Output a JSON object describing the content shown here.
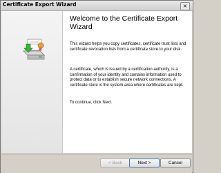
{
  "window": {
    "title": "Certificate Export Wizard",
    "close_glyph": "×"
  },
  "left_panel": {
    "icon": "certificate-export-icon"
  },
  "content": {
    "heading": "Welcome to the Certificate Export Wizard",
    "paragraph1": "This wizard helps you copy certificates, certificate trust lists and certificate revocation lists from a certificate store to your disk.",
    "paragraph2": "A certificate, which is issued by a certification authority, is a confirmation of your identity and contains information used to protect data or to establish secure network connections. A certificate store is the system area where certificates are kept.",
    "paragraph3": "To continue, click Next."
  },
  "buttons": {
    "back": "< Back",
    "next": "Next >",
    "cancel": "Cancel"
  }
}
